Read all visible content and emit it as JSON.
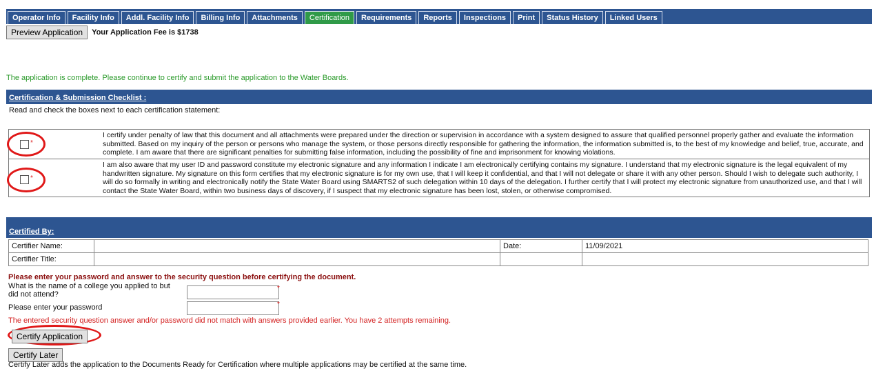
{
  "tabs": [
    {
      "label": "Operator Info",
      "active": false
    },
    {
      "label": "Facility Info",
      "active": false
    },
    {
      "label": "Addl. Facility Info",
      "active": false
    },
    {
      "label": "Billing Info",
      "active": false
    },
    {
      "label": "Attachments",
      "active": false
    },
    {
      "label": "Certification",
      "active": true
    },
    {
      "label": "Requirements",
      "active": false
    },
    {
      "label": "Reports",
      "active": false
    },
    {
      "label": "Inspections",
      "active": false
    },
    {
      "label": "Print",
      "active": false
    },
    {
      "label": "Status History",
      "active": false
    },
    {
      "label": "Linked Users",
      "active": false
    }
  ],
  "preview_button": "Preview Application",
  "fee_text": "Your Application Fee is $1738",
  "status_message": "The application is complete. Please continue to certify and submit the application to the Water Boards.",
  "checklist": {
    "heading": "Certification & Submission Checklist :",
    "instruction": "Read and check the boxes next to each certification statement:",
    "required_mark": "*",
    "statements": [
      "I certify under penalty of law that this document and all attachments were prepared under the direction or supervision in accordance with a system designed to assure that qualified personnel properly gather and evaluate the information submitted. Based on my inquiry of the person or persons who manage the system, or those persons directly responsible for gathering the information, the information submitted is, to the best of my knowledge and belief, true, accurate, and complete. I am aware that there are significant penalties for submitting false information, including the possibility of fine and imprisonment for knowing violations.",
      "I am also aware that my user ID and password constitute my electronic signature and any information I indicate I am electronically certifying contains my signature. I understand that my electronic signature is the legal equivalent of my handwritten signature. My signature on this form certifies that my electronic signature is for my own use, that I will keep it confidential, and that I will not delegate or share it with any other person. Should I wish to delegate such authority, I will do so formally in writing and electronically notify the State Water Board using SMARTS2 of such delegation within 10 days of the delegation. I further certify that I will protect my electronic signature from unauthorized use, and that I will contact the State Water Board, within two business days of discovery, if I suspect that my electronic signature has been lost, stolen, or otherwise compromised."
    ]
  },
  "certified_by": {
    "heading": "Certified By:",
    "name_label": "Certifier Name:",
    "title_label": "Certifier Title:",
    "date_label": "Date:",
    "date_value": "11/09/2021"
  },
  "security": {
    "warning": "Please enter your password and answer to the security question before certifying the document.",
    "question": "What is the name of a college you applied to but did not attend?",
    "password_label": "Please enter your password",
    "required_mark": "*",
    "error": "The entered security question answer and/or password did not match with answers provided earlier. You have 2 attempts remaining."
  },
  "certify_button": "Certify Application",
  "later_button": "Certify Later",
  "later_note": "Certify Later adds the application to the Documents Ready for Certification where multiple applications may be certified at the same time."
}
